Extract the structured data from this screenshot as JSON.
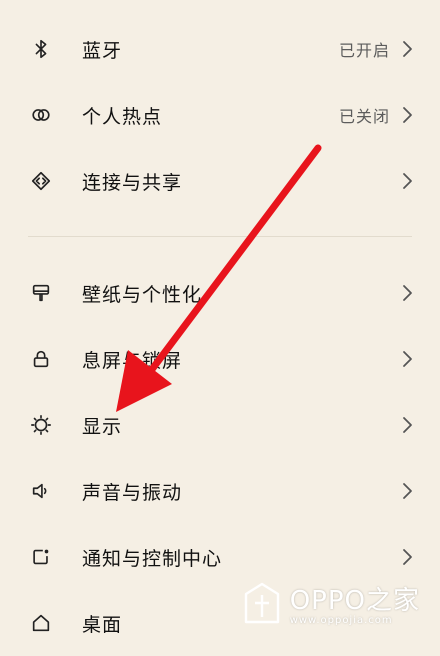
{
  "settings": {
    "connectivity": [
      {
        "label": "蓝牙",
        "status": "已开启",
        "icon": "bluetooth-icon"
      },
      {
        "label": "个人热点",
        "status": "已关闭",
        "icon": "hotspot-icon"
      },
      {
        "label": "连接与共享",
        "status": "",
        "icon": "connection-share-icon"
      }
    ],
    "personal": [
      {
        "label": "壁纸与个性化",
        "icon": "brush-icon"
      },
      {
        "label": "息屏与锁屏",
        "icon": "lock-icon"
      },
      {
        "label": "显示",
        "icon": "brightness-icon"
      },
      {
        "label": "声音与振动",
        "icon": "speaker-icon"
      },
      {
        "label": "通知与控制中心",
        "icon": "notification-icon"
      },
      {
        "label": "桌面",
        "icon": "home-icon"
      }
    ]
  },
  "watermark": {
    "brand": "OPPO之家",
    "url": "www.oppojia.com"
  },
  "colors": {
    "background": "#f5efe4",
    "arrow": "#e8141c",
    "text": "#111111",
    "secondary_text": "#5c5c5c"
  }
}
